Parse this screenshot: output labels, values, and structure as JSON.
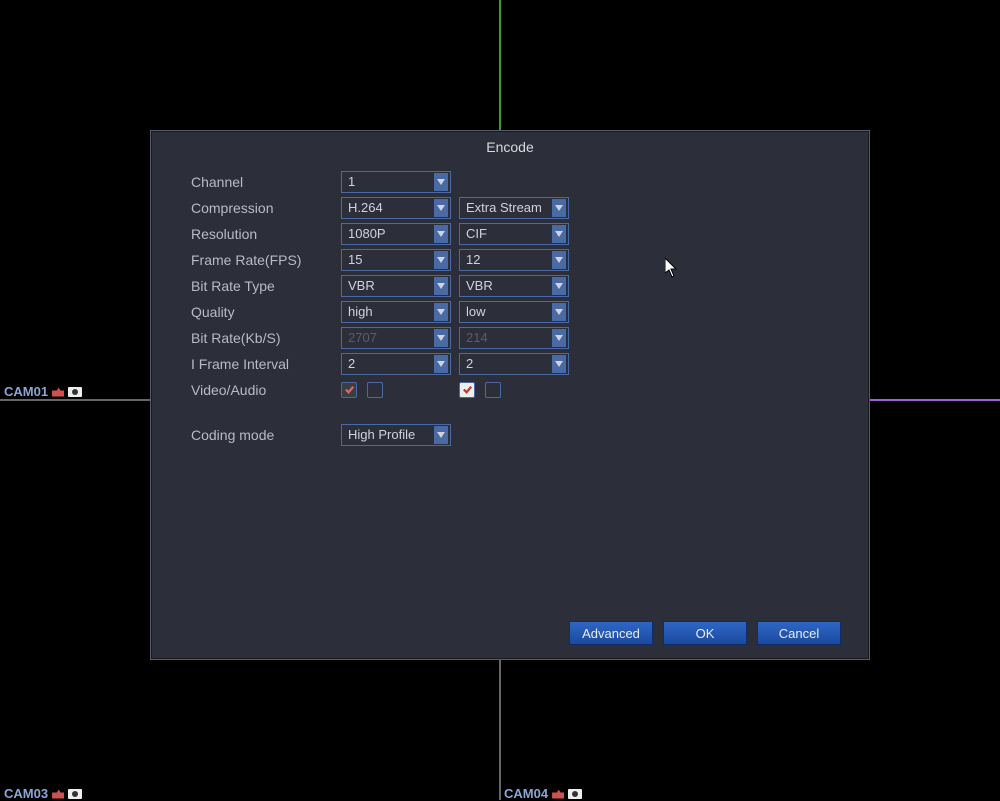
{
  "cameras": {
    "cam1": "CAM01",
    "cam3": "CAM03",
    "cam4": "CAM04"
  },
  "dialog": {
    "title": "Encode",
    "labels": {
      "channel": "Channel",
      "compression": "Compression",
      "resolution": "Resolution",
      "frame_rate": "Frame Rate(FPS)",
      "bit_rate_type": "Bit Rate Type",
      "quality": "Quality",
      "bit_rate": "Bit Rate(Kb/S)",
      "i_frame": "I Frame Interval",
      "video_audio": "Video/Audio",
      "coding_mode": "Coding mode"
    },
    "main": {
      "channel": "1",
      "compression": "H.264",
      "resolution": "1080P",
      "frame_rate": "15",
      "bit_rate_type": "VBR",
      "quality": "high",
      "bit_rate": "2707",
      "i_frame": "2"
    },
    "extra": {
      "compression": "Extra Stream",
      "resolution": "CIF",
      "frame_rate": "12",
      "bit_rate_type": "VBR",
      "quality": "low",
      "bit_rate": "214",
      "i_frame": "2"
    },
    "coding_mode": "High Profile",
    "buttons": {
      "advanced": "Advanced",
      "ok": "OK",
      "cancel": "Cancel"
    }
  }
}
